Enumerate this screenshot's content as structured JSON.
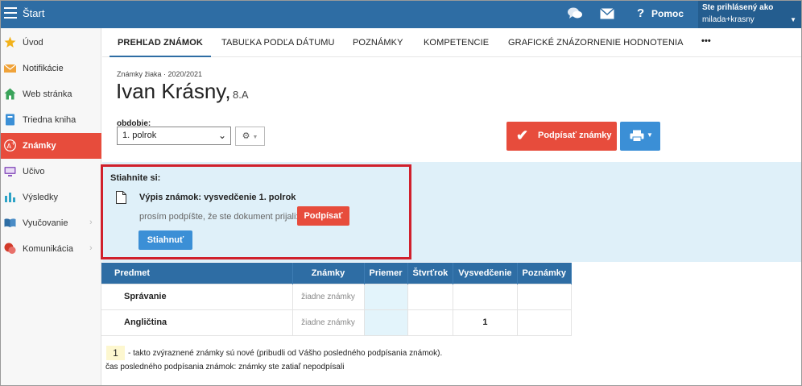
{
  "topbar": {
    "app_title": "Štart",
    "help_label": "Pomoc",
    "user_line1": "Ste prihlásený ako",
    "user_line2": "milada+krasny"
  },
  "sidebar": {
    "items": [
      {
        "label": "Úvod",
        "icon": "star-icon",
        "color": "#f2b21b"
      },
      {
        "label": "Notifikácie",
        "icon": "envelope-icon",
        "color": "#f0a33a"
      },
      {
        "label": "Web stránka",
        "icon": "house-icon",
        "color": "#3aa35a"
      },
      {
        "label": "Triedna kniha",
        "icon": "book-icon",
        "color": "#3b8fd6"
      },
      {
        "label": "Známky",
        "icon": "grade-icon",
        "color": "#ffffff"
      },
      {
        "label": "Učivo",
        "icon": "monitor-icon",
        "color": "#8e5ac0"
      },
      {
        "label": "Výsledky",
        "icon": "bar-chart-icon",
        "color": "#2ea3c6"
      },
      {
        "label": "Vyučovanie",
        "icon": "open-book-icon",
        "color": "#2e6da4"
      },
      {
        "label": "Komunikácia",
        "icon": "chat-icon",
        "color": "#d23a2a"
      }
    ]
  },
  "tabs": [
    "PREHĽAD ZNÁMOK",
    "TABUĽKA PODĽA DÁTUMU",
    "POZNÁMKY",
    "KOMPETENCIE",
    "GRAFICKÉ ZNÁZORNENIE HODNOTENIA",
    "•••"
  ],
  "header": {
    "crumb": "Známky žiaka · 2020/2021",
    "student_name": "Ivan Krásny,",
    "student_class": "8.A",
    "period_label": "obdobie:",
    "period_value": "1. polrok",
    "sign_button": "Podpísať známky"
  },
  "download": {
    "title": "Stiahnite si:",
    "doc_name": "Výpis známok: vysvedčenie 1. polrok",
    "note": "prosím podpíšte, že ste dokument prijali:",
    "sign_label": "Podpísať",
    "download_label": "Stiahnuť"
  },
  "table": {
    "headers": [
      "Predmet",
      "Známky",
      "Priemer",
      "Štvrťrok",
      "Vysvedčenie",
      "Poznámky"
    ],
    "rows": [
      {
        "subject": "Správanie",
        "marks": "žiadne známky",
        "avg": "",
        "quarter": "",
        "cert": "",
        "notes": ""
      },
      {
        "subject": "Angličtina",
        "marks": "žiadne známky",
        "avg": "",
        "quarter": "",
        "cert": "1",
        "notes": ""
      }
    ]
  },
  "legend": {
    "sample": "1",
    "text": "- takto zvýraznené známky sú nové (pribudli od Vášho posledného podpísania známok).",
    "last_sign": "čas posledného podpísania známok: známky ste zatiaľ nepodpísali"
  },
  "colors": {
    "primary": "#2e6da4",
    "accent_red": "#e74c3c",
    "button_blue": "#3b8fd6",
    "panel_bg": "#dff0f9",
    "highlight_frame": "#d0202c"
  }
}
